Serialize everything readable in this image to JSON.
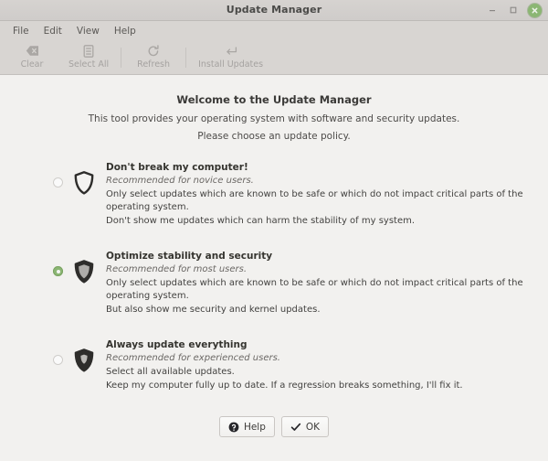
{
  "window": {
    "title": "Update Manager",
    "buttons": {
      "minimize": "minimize",
      "maximize": "maximize",
      "close": "close"
    }
  },
  "menubar": {
    "items": [
      {
        "label": "File"
      },
      {
        "label": "Edit"
      },
      {
        "label": "View"
      },
      {
        "label": "Help"
      }
    ]
  },
  "toolbar": {
    "items": [
      {
        "label": "Clear",
        "icon": "clear-icon",
        "enabled": false
      },
      {
        "label": "Select All",
        "icon": "select-all-icon",
        "enabled": false
      },
      {
        "label": "Refresh",
        "icon": "refresh-icon",
        "enabled": false
      },
      {
        "label": "Install Updates",
        "icon": "install-updates-icon",
        "enabled": false
      }
    ]
  },
  "welcome": {
    "heading": "Welcome to the Update Manager",
    "line1": "This tool provides your operating system with software and security updates.",
    "line2": "Please choose an update policy."
  },
  "policies": [
    {
      "title": "Don't break my computer!",
      "recommendation": "Recommended for novice users.",
      "desc1": "Only select updates which are known to be safe or which do not impact critical parts of the operating system.",
      "desc2": "Don't show me updates which can harm the stability of my system.",
      "selected": false,
      "shield": "shield-outline-icon"
    },
    {
      "title": "Optimize stability and security",
      "recommendation": "Recommended for most users.",
      "desc1": "Only select updates which are known to be safe or which do not impact critical parts of the operating system.",
      "desc2": "But also show me security and kernel updates.",
      "selected": true,
      "shield": "shield-half-icon"
    },
    {
      "title": "Always update everything",
      "recommendation": "Recommended for experienced users.",
      "desc1": "Select all available updates.",
      "desc2": "Keep my computer fully up to date. If a regression breaks something, I'll fix it.",
      "selected": false,
      "shield": "shield-full-icon"
    }
  ],
  "footer": {
    "help_label": "Help",
    "ok_label": "OK"
  },
  "colors": {
    "accent_green": "#8bb673",
    "titlebar": "#d4d1ce",
    "toolbar": "#d8d5d2",
    "content_bg": "#f2f1ef"
  }
}
